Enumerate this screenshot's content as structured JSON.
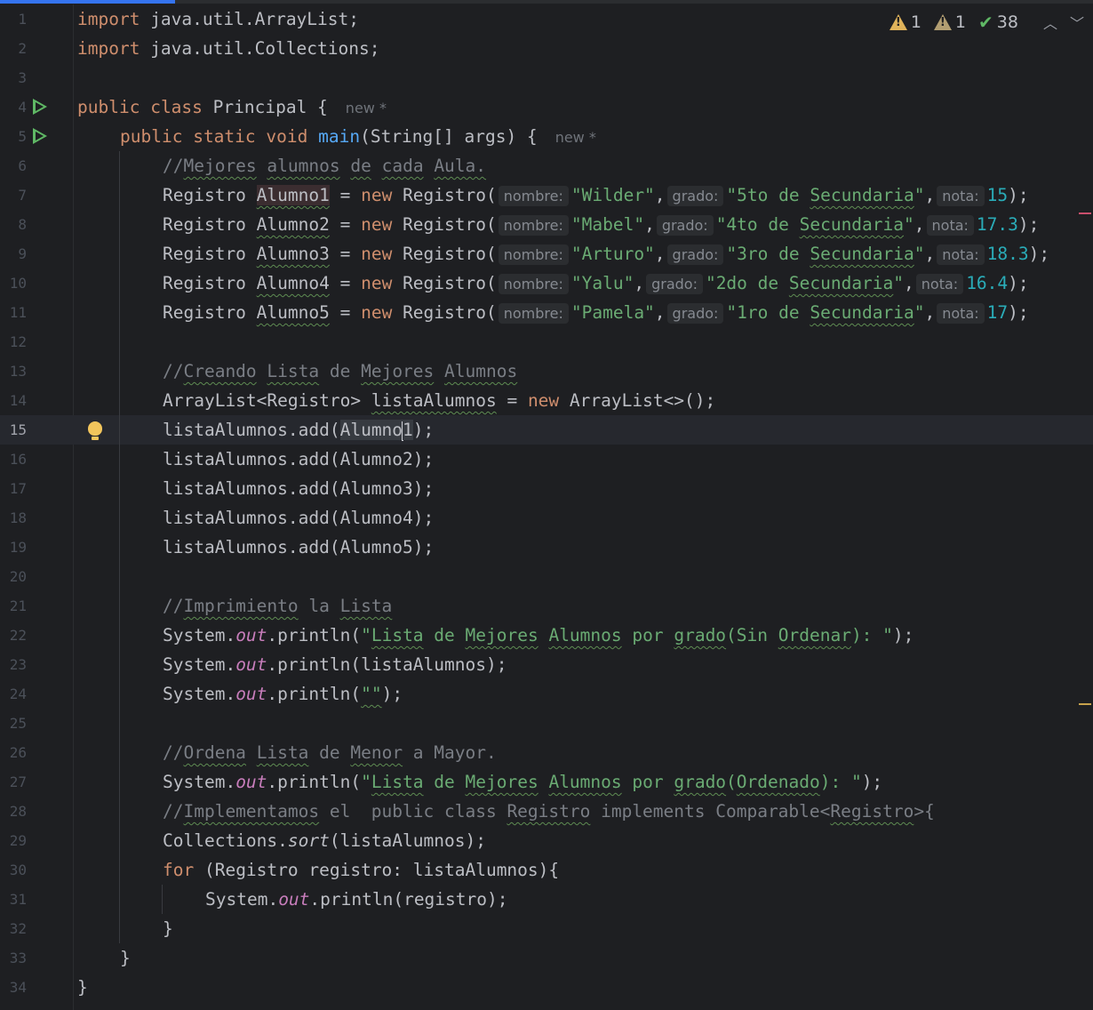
{
  "indicators": {
    "warnings_count": "1",
    "weak_warnings_count": "1",
    "typos_count": "38"
  },
  "progress_fraction": 0.16,
  "colors": {
    "background": "#1e1f22",
    "keyword": "#cf8e6d",
    "string": "#6aab73",
    "number": "#2aacb8",
    "comment": "#7a7e85",
    "method": "#56a8f5",
    "field": "#c77dbb",
    "run_icon": "#5fb865"
  },
  "icons": [
    "warning-icon",
    "weak-warning-icon",
    "typo-check-icon",
    "chevron-up-icon",
    "chevron-down-icon",
    "run-icon",
    "bulb-icon"
  ],
  "editor": {
    "current_line": 15,
    "line_numbers": [
      "1",
      "2",
      "3",
      "4",
      "5",
      "6",
      "7",
      "8",
      "9",
      "10",
      "11",
      "12",
      "13",
      "14",
      "15",
      "16",
      "17",
      "18",
      "19",
      "20",
      "21",
      "22",
      "23",
      "24",
      "25",
      "26",
      "27",
      "28",
      "29",
      "30",
      "31",
      "32",
      "33",
      "34"
    ],
    "author_hint": "new *",
    "param_hints": {
      "nombre": "nombre:",
      "grado": "grado:",
      "nota": "nota:"
    },
    "lines": {
      "l1": {
        "kw": "import",
        "rest": " java.util.ArrayList;"
      },
      "l2": {
        "kw": "import",
        "rest": " java.util.Collections;"
      },
      "l4": {
        "kw1": "public",
        "kw2": "class",
        "name": " Principal {"
      },
      "l5": {
        "kw1": "public",
        "kw2": "static",
        "kw3": "void",
        "method": "main",
        "rest": "(String[] args) {"
      },
      "l6": {
        "comment_prefix": "//",
        "w1": "Mejores",
        "w2": "alumnos",
        "w3": "de",
        "w4": "cada",
        "w5": "Aula."
      },
      "students": [
        {
          "var": "Alumno1",
          "name": "\"Wilder\"",
          "grade_num": "\"5to de ",
          "grade_word": "Secundaria",
          "grade_end": "\"",
          "nota": "15"
        },
        {
          "var": "Alumno2",
          "name": "\"Mabel\"",
          "grade_num": "\"4to de ",
          "grade_word": "Secundaria",
          "grade_end": "\"",
          "nota": "17.3"
        },
        {
          "var": "Alumno3",
          "name": "\"Arturo\"",
          "grade_num": "\"3ro de ",
          "grade_word": "Secundaria",
          "grade_end": "\"",
          "nota": "18.3"
        },
        {
          "var": "Alumno4",
          "name": "\"Yalu\"",
          "grade_num": "\"2do de ",
          "grade_word": "Secundaria",
          "grade_end": "\"",
          "nota": "16.4"
        },
        {
          "var": "Alumno5",
          "name": "\"Pamela\"",
          "grade_num": "\"1ro de ",
          "grade_word": "Secundaria",
          "grade_end": "\"",
          "nota": "17"
        }
      ],
      "reg_type": "Registro ",
      "reg_new": "new",
      "reg_ctor": " Registro(",
      "l13": {
        "prefix": "//",
        "w1": "Creando",
        "w2": "Lista",
        "w3": " de ",
        "w4": "Mejores",
        "w5": "Alumnos"
      },
      "l14": {
        "type": "ArrayList<Registro> ",
        "var": "listaAlumnos",
        "eq": " = ",
        "kw": "new",
        "rest": " ArrayList<>();"
      },
      "l15": {
        "pre": "listaAlumnos.add(",
        "arg_a": "Alumno",
        "arg_b": "1",
        "post": ");"
      },
      "adds": [
        "listaAlumnos.add(Alumno2);",
        "listaAlumnos.add(Alumno3);",
        "listaAlumnos.add(Alumno4);",
        "listaAlumnos.add(Alumno5);"
      ],
      "l21": {
        "prefix": "//",
        "w1": "Imprimiento",
        "w2": " la ",
        "w3": "Lista"
      },
      "l22": {
        "a": "System.",
        "out": "out",
        "b": ".println(",
        "s1": "\"",
        "s2": "Lista",
        "s3": " de ",
        "s4": "Mejores",
        "s5": " ",
        "s6": "Alumnos",
        "s7": " por ",
        "s8": "grado",
        "s9": "(Sin ",
        "s10": "Ordenar",
        "s11": "): \"",
        "end": ");"
      },
      "l23": {
        "a": "System.",
        "out": "out",
        "b": ".println(listaAlumnos);"
      },
      "l24": {
        "a": "System.",
        "out": "out",
        "b": ".println(",
        "s": "\"\"",
        "end": ");"
      },
      "l26": {
        "prefix": "//",
        "w1": "Ordena",
        "w2": " ",
        "w3": "Lista",
        "w4": " de ",
        "w5": "Menor",
        "w6": " a Mayor."
      },
      "l27": {
        "a": "System.",
        "out": "out",
        "b": ".println(",
        "s1": "\"",
        "s2": "Lista",
        "s3": " de ",
        "s4": "Mejores",
        "s5": " ",
        "s6": "Alumnos",
        "s7": " por ",
        "s8": "grado",
        "s9": "(",
        "s10": "Ordenado",
        "s11": "): \"",
        "end": ");"
      },
      "l28": {
        "prefix": "//",
        "w1": "Implementamos",
        "w2": " el  public class ",
        "w3": "Registro",
        "w4": " implements Comparable<",
        "w5": "Registro",
        "w6": ">{"
      },
      "l29": {
        "a": "Collections.",
        "sort": "sort",
        "b": "(listaAlumnos);"
      },
      "l30": {
        "kw": "for",
        "rest": " (Registro registro: listaAlumnos){"
      },
      "l31": {
        "a": "System.",
        "out": "out",
        "b": ".println(registro);"
      },
      "close_brace": "}"
    }
  }
}
